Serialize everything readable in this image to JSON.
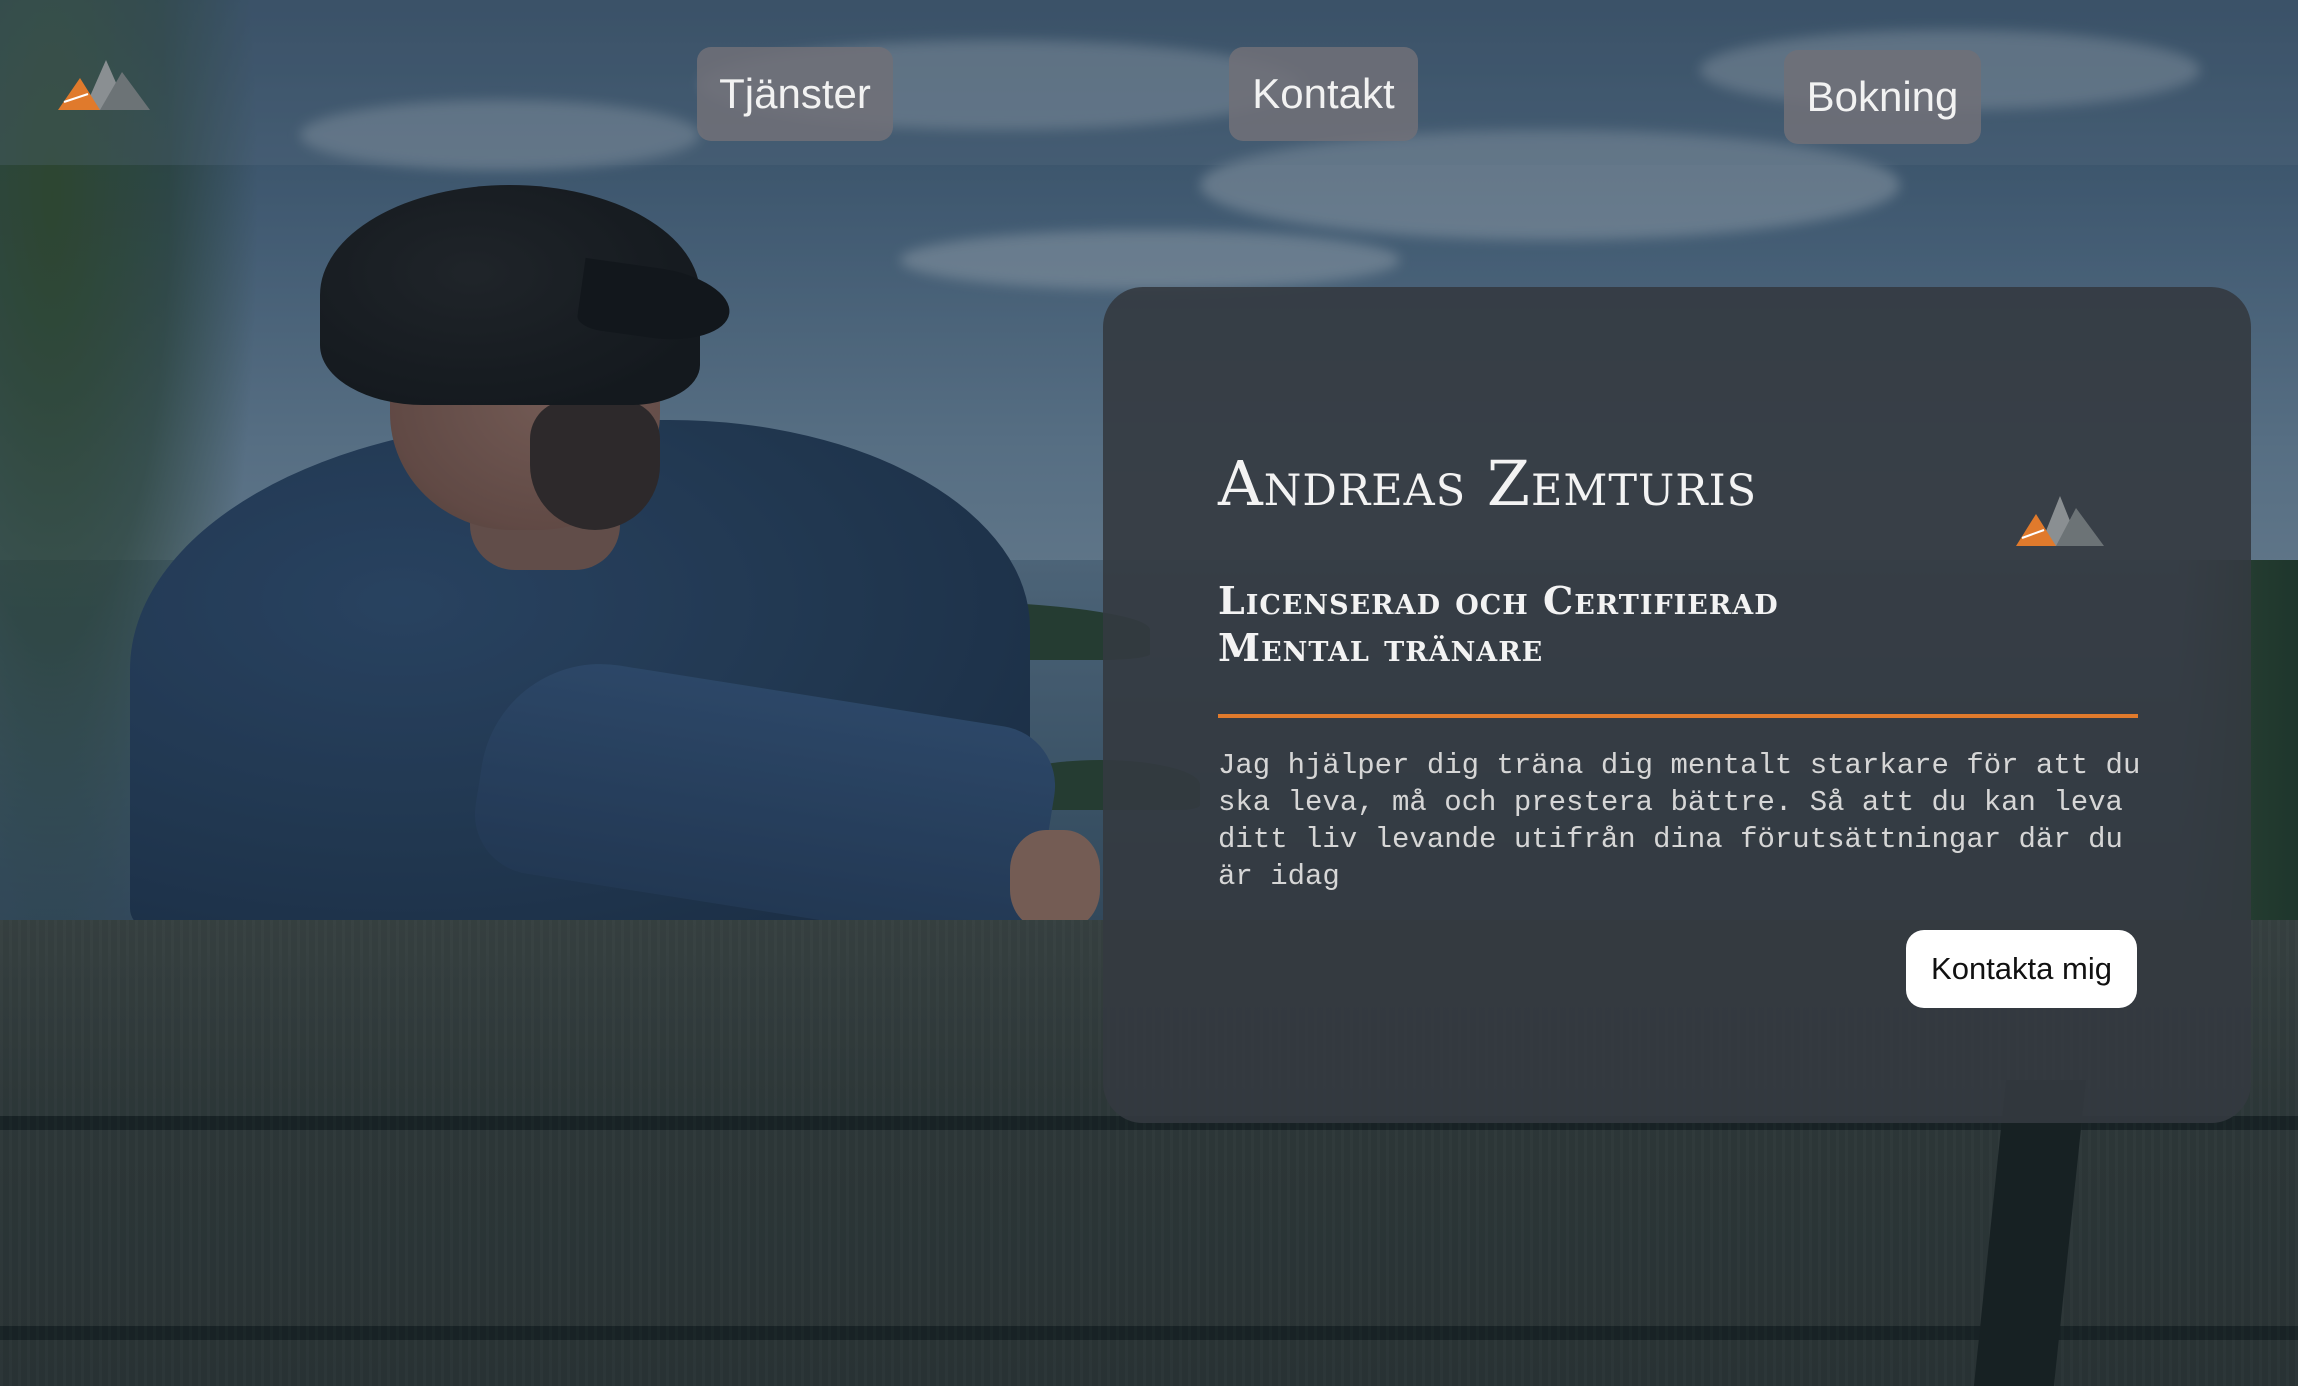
{
  "brand": {
    "logo_icon": "mountain-logo-icon",
    "accent_color": "#e07a2c"
  },
  "nav": {
    "items": [
      {
        "label": "Tjänster"
      },
      {
        "label": "Kontakt"
      },
      {
        "label": "Bokning"
      }
    ]
  },
  "hero": {
    "name": "Andreas Zemturis",
    "subtitle_line1": "Licenserad och Certifierad",
    "subtitle_line2": "Mental tränare",
    "description": "Jag hjälper dig träna dig mentalt starkare för att du ska leva, må och prestera bättre. Så att du kan leva ditt liv levande utifrån dina förutsättningar där du är idag",
    "cta_label": "Kontakta mig"
  }
}
